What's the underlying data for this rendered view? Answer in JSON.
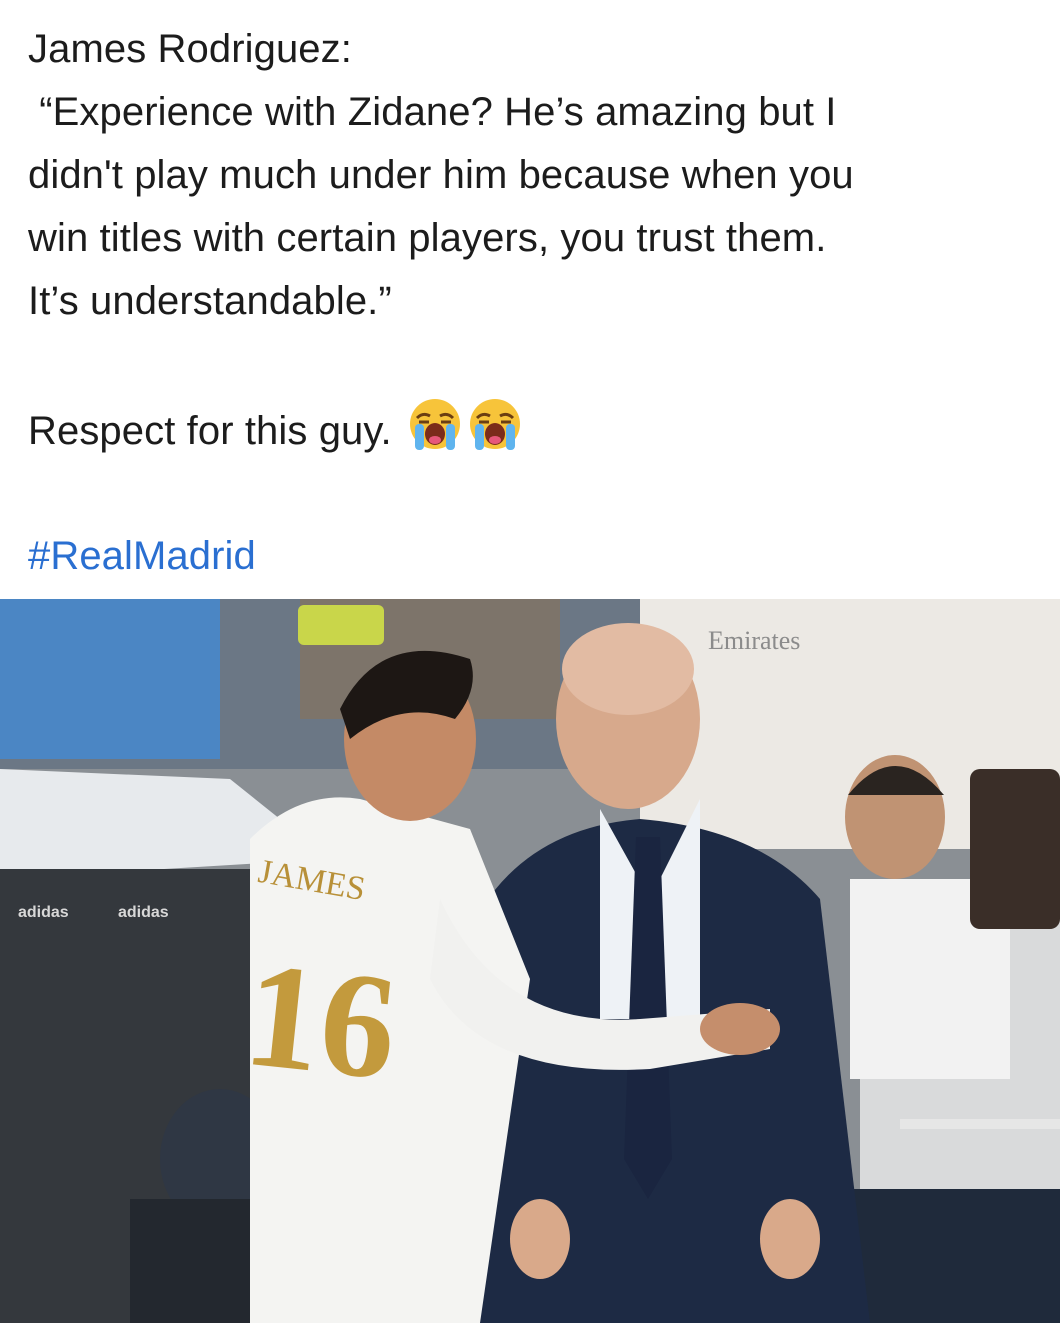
{
  "post": {
    "author_line": "James Rodriguez:",
    "quote_lines": [
      " “Experience with Zidane? He’s amazing but I",
      "didn't play much under him because when you",
      "win titles with certain players, you trust them.",
      "It’s understandable.”"
    ],
    "comment_text": "Respect for this guy.",
    "emoji_names": [
      "loudly-crying-face-emoji",
      "loudly-crying-face-emoji"
    ],
    "hashtag": "#RealMadrid",
    "hashtag_color": "#2a6fd1"
  },
  "photo": {
    "jersey_name": "JAMES",
    "jersey_number": "16",
    "sponsor_text": "Emirates",
    "ad_board_text": "adidas"
  }
}
